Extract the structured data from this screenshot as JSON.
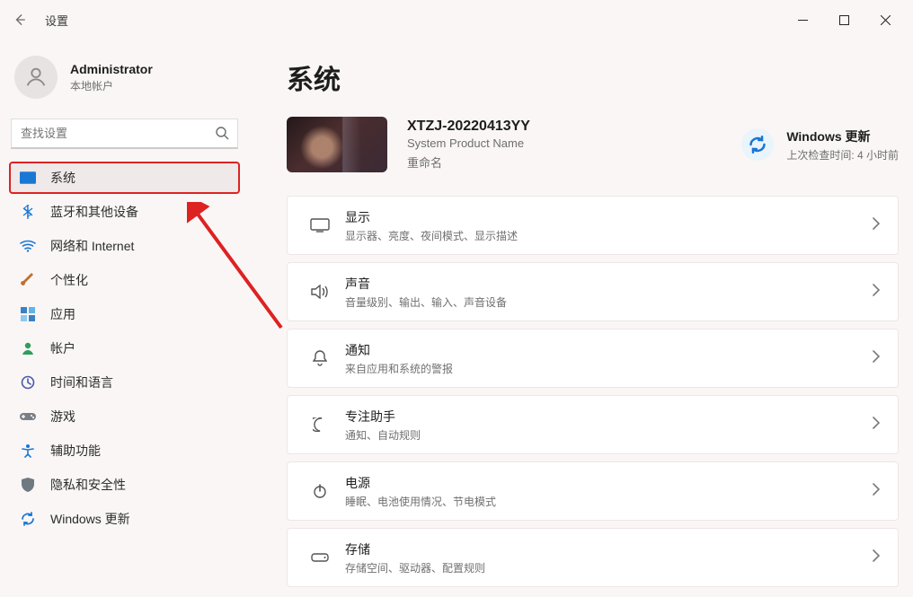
{
  "titlebar": {
    "app_title": "设置"
  },
  "user": {
    "name": "Administrator",
    "subtitle": "本地帐户"
  },
  "search": {
    "placeholder": "查找设置"
  },
  "nav": [
    {
      "label": "系统",
      "icon": "system"
    },
    {
      "label": "蓝牙和其他设备",
      "icon": "bluetooth"
    },
    {
      "label": "网络和 Internet",
      "icon": "wifi"
    },
    {
      "label": "个性化",
      "icon": "brush"
    },
    {
      "label": "应用",
      "icon": "apps"
    },
    {
      "label": "帐户",
      "icon": "account"
    },
    {
      "label": "时间和语言",
      "icon": "clock"
    },
    {
      "label": "游戏",
      "icon": "game"
    },
    {
      "label": "辅助功能",
      "icon": "accessibility"
    },
    {
      "label": "隐私和安全性",
      "icon": "shield"
    },
    {
      "label": "Windows 更新",
      "icon": "update"
    }
  ],
  "page": {
    "title": "系统",
    "device_name": "XTZJ-20220413YY",
    "product_name": "System Product Name",
    "rename": "重命名"
  },
  "update": {
    "title": "Windows 更新",
    "last_check": "上次检查时间: 4 小时前"
  },
  "cards": [
    {
      "title": "显示",
      "subtitle": "显示器、亮度、夜间模式、显示描述",
      "icon": "display"
    },
    {
      "title": "声音",
      "subtitle": "音量级别、输出、输入、声音设备",
      "icon": "sound"
    },
    {
      "title": "通知",
      "subtitle": "来自应用和系统的警报",
      "icon": "bell"
    },
    {
      "title": "专注助手",
      "subtitle": "通知、自动规则",
      "icon": "moon"
    },
    {
      "title": "电源",
      "subtitle": "睡眠、电池使用情况、节电模式",
      "icon": "power"
    },
    {
      "title": "存储",
      "subtitle": "存储空间、驱动器、配置规则",
      "icon": "storage"
    }
  ]
}
